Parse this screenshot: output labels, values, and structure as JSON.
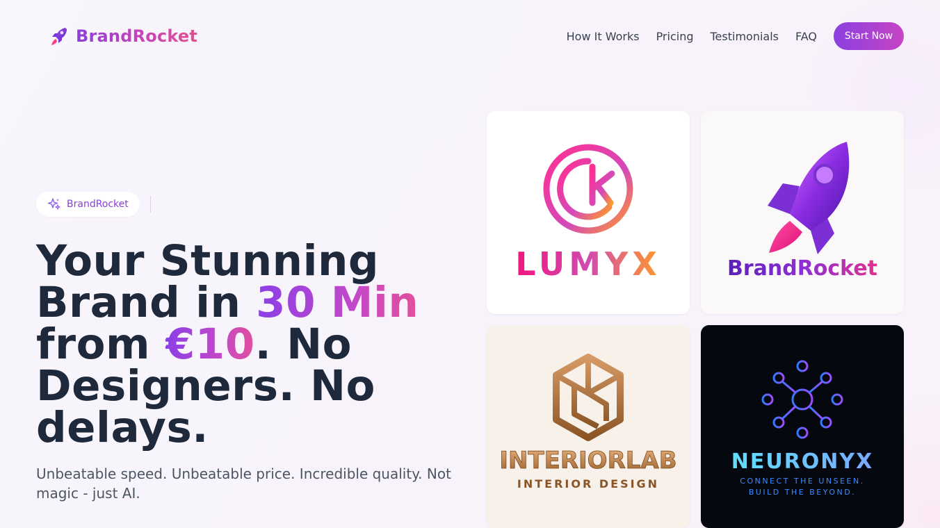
{
  "header": {
    "brand_name": "BrandRocket",
    "nav": [
      "How It Works",
      "Pricing",
      "Testimonials",
      "FAQ"
    ],
    "cta": "Start Now"
  },
  "hero": {
    "badge": "BrandRocket",
    "headline": {
      "part1": "Your Stunning Brand in ",
      "highlight1": "30 Min",
      "part2": " from ",
      "highlight2": "€10",
      "part3": ". No Designers. No delays."
    },
    "subtitle": "Unbeatable speed. Unbeatable price. Incredible quality. Not magic - just AI."
  },
  "logos": [
    {
      "name": "LUMYX",
      "icon": "lumyx-circle-k-logo"
    },
    {
      "name": "BrandRocket",
      "icon": "rocket-logo"
    },
    {
      "name": "INTERIORLAB",
      "tagline": "INTERIOR DESIGN",
      "icon": "cube-logo"
    },
    {
      "name": "NEURONYX",
      "tagline_line1": "CONNECT THE UNSEEN.",
      "tagline_line2": "BUILD THE BEYOND.",
      "icon": "neural-network-logo"
    }
  ],
  "colors": {
    "accent_purple": "#8b3fd9",
    "accent_pink": "#e0508f",
    "headline": "#1e293b",
    "neuronyx_cyan": "#5fd4ff"
  }
}
